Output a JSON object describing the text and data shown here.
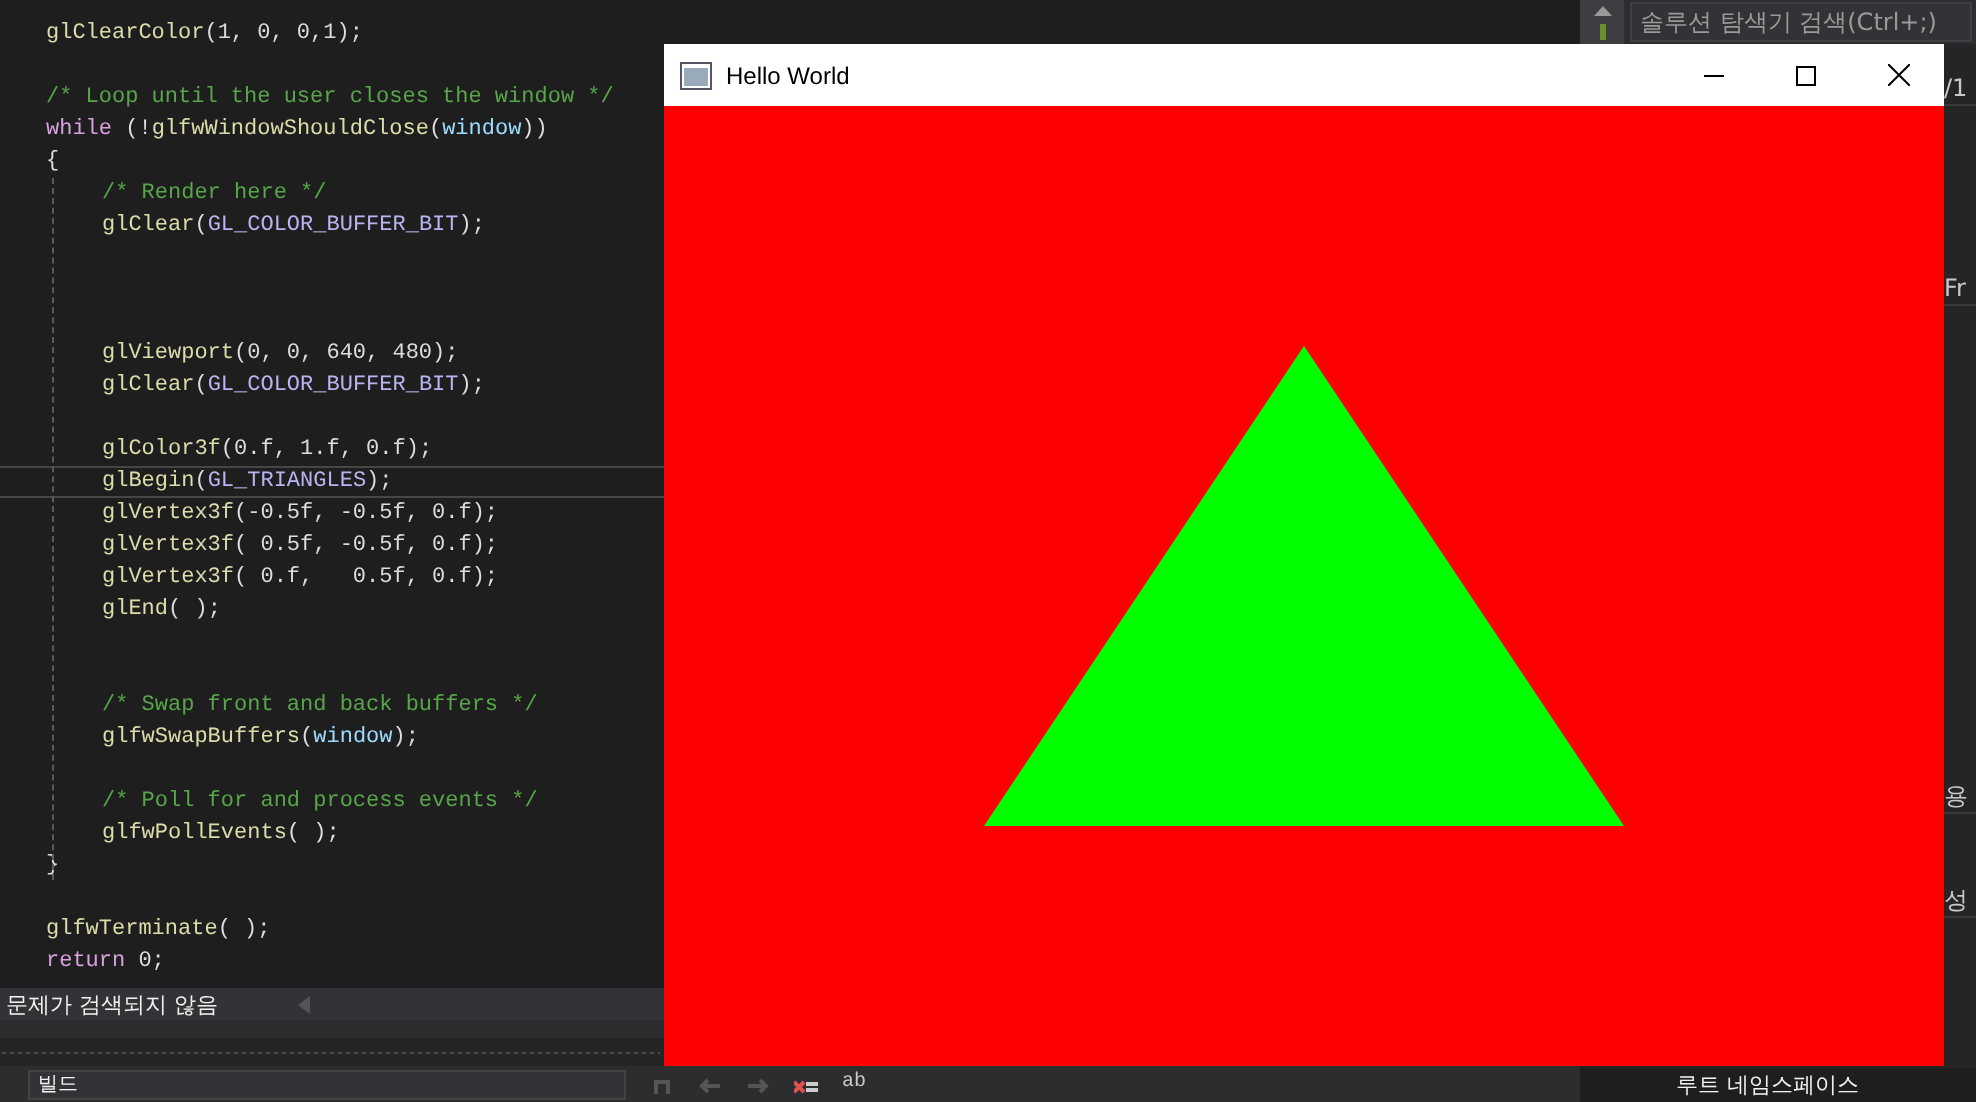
{
  "editor": {
    "lines": [
      {
        "current": false,
        "indented": false,
        "segments": [
          {
            "kind": "function",
            "text": "glClearColor"
          },
          {
            "kind": "plain",
            "text": "(1, 0, 0,1);"
          }
        ]
      },
      {
        "current": false
      },
      {
        "current": false,
        "indented": false,
        "segments": [
          {
            "kind": "comment",
            "text": "/* Loop until the user closes the window */"
          }
        ]
      },
      {
        "current": false,
        "indented": false,
        "segments": [
          {
            "kind": "keyword",
            "text": "while"
          },
          {
            "kind": "plain",
            "text": " (!"
          },
          {
            "kind": "function",
            "text": "glfwWindowShouldClose"
          },
          {
            "kind": "plain",
            "text": "("
          },
          {
            "kind": "variable",
            "text": "window"
          },
          {
            "kind": "plain",
            "text": "))"
          }
        ]
      },
      {
        "current": false,
        "indented": false,
        "segments": [
          {
            "kind": "plain",
            "text": "{"
          }
        ]
      },
      {
        "current": false,
        "indented": true,
        "segments": [
          {
            "kind": "comment",
            "text": "/* Render here */"
          }
        ]
      },
      {
        "current": false,
        "indented": true,
        "segments": [
          {
            "kind": "function",
            "text": "glClear"
          },
          {
            "kind": "plain",
            "text": "("
          },
          {
            "kind": "macro",
            "text": "GL_COLOR_BUFFER_BIT"
          },
          {
            "kind": "plain",
            "text": ");"
          }
        ]
      },
      {
        "current": false
      },
      {
        "current": false
      },
      {
        "current": false
      },
      {
        "current": false,
        "indented": true,
        "segments": [
          {
            "kind": "function",
            "text": "glViewport"
          },
          {
            "kind": "plain",
            "text": "(0, 0, 640, 480);"
          }
        ]
      },
      {
        "current": false,
        "indented": true,
        "segments": [
          {
            "kind": "function",
            "text": "glClear"
          },
          {
            "kind": "plain",
            "text": "("
          },
          {
            "kind": "macro",
            "text": "GL_COLOR_BUFFER_BIT"
          },
          {
            "kind": "plain",
            "text": ");"
          }
        ]
      },
      {
        "current": false
      },
      {
        "current": false,
        "indented": true,
        "segments": [
          {
            "kind": "function",
            "text": "glColor3f"
          },
          {
            "kind": "plain",
            "text": "(0.f, 1.f, 0.f);"
          }
        ]
      },
      {
        "current": true,
        "indented": true,
        "segments": [
          {
            "kind": "function",
            "text": "glBegin"
          },
          {
            "kind": "plain",
            "text": "("
          },
          {
            "kind": "macro",
            "text": "GL_TRIANGLES"
          },
          {
            "kind": "plain",
            "text": ");"
          }
        ]
      },
      {
        "current": false,
        "indented": true,
        "segments": [
          {
            "kind": "function",
            "text": "glVertex3f"
          },
          {
            "kind": "plain",
            "text": "(-0.5f, -0.5f, 0.f);"
          }
        ]
      },
      {
        "current": false,
        "indented": true,
        "segments": [
          {
            "kind": "function",
            "text": "glVertex3f"
          },
          {
            "kind": "plain",
            "text": "( 0.5f, -0.5f, 0.f);"
          }
        ]
      },
      {
        "current": false,
        "indented": true,
        "segments": [
          {
            "kind": "function",
            "text": "glVertex3f"
          },
          {
            "kind": "plain",
            "text": "( 0.f,   0.5f, 0.f);"
          }
        ]
      },
      {
        "current": false,
        "indented": true,
        "segments": [
          {
            "kind": "function",
            "text": "glEnd"
          },
          {
            "kind": "plain",
            "text": "( );"
          }
        ]
      },
      {
        "current": false
      },
      {
        "current": false
      },
      {
        "current": false,
        "indented": true,
        "segments": [
          {
            "kind": "comment",
            "text": "/* Swap front and back buffers */"
          }
        ]
      },
      {
        "current": false,
        "indented": true,
        "segments": [
          {
            "kind": "function",
            "text": "glfwSwapBuffers"
          },
          {
            "kind": "plain",
            "text": "("
          },
          {
            "kind": "variable",
            "text": "window"
          },
          {
            "kind": "plain",
            "text": ");"
          }
        ]
      },
      {
        "current": false
      },
      {
        "current": false,
        "indented": true,
        "segments": [
          {
            "kind": "comment",
            "text": "/* Poll for and process events */"
          }
        ]
      },
      {
        "current": false,
        "indented": true,
        "segments": [
          {
            "kind": "function",
            "text": "glfwPollEvents"
          },
          {
            "kind": "plain",
            "text": "( );"
          }
        ]
      },
      {
        "current": false,
        "indented": false,
        "segments": [
          {
            "kind": "plain",
            "text": "}"
          }
        ]
      },
      {
        "current": false
      },
      {
        "current": false,
        "indented": false,
        "segments": [
          {
            "kind": "function",
            "text": "glfwTerminate"
          },
          {
            "kind": "plain",
            "text": "( );"
          }
        ]
      },
      {
        "current": false,
        "indented": false,
        "segments": [
          {
            "kind": "keyword",
            "text": "return"
          },
          {
            "kind": "plain",
            "text": " 0;"
          }
        ]
      }
    ]
  },
  "status": {
    "text": "문제가 검색되지 않음"
  },
  "output_panel": {
    "dropdown": "빌드",
    "toolbar_text": "ab"
  },
  "solution_explorer": {
    "search_placeholder": "솔루션 탐색기 검색(Ctrl+;)",
    "fragments": [
      "/1",
      "Fr",
      "용",
      "성"
    ],
    "root_label": "루트 네임스페이스"
  },
  "app_window": {
    "title": "Hello World"
  }
}
